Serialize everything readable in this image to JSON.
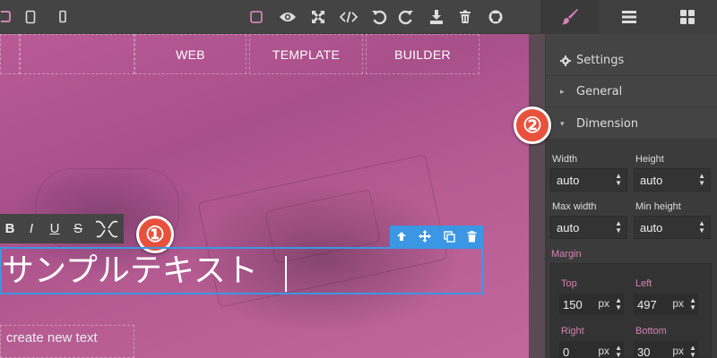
{
  "colors": {
    "accent_pink": "#d582b4",
    "accent_blue": "#3b97e3",
    "badge_red": "#e8513c",
    "panel_bg": "#444444"
  },
  "topbar": {
    "device_buttons": [
      {
        "icon": "desktop-icon",
        "active": true
      },
      {
        "icon": "tablet-icon",
        "active": false
      },
      {
        "icon": "mobile-icon",
        "active": false
      }
    ],
    "actions": [
      {
        "icon": "square-outline-icon",
        "active": true
      },
      {
        "icon": "eye-icon"
      },
      {
        "icon": "fullscreen-icon"
      },
      {
        "icon": "code-icon"
      },
      {
        "icon": "undo-icon"
      },
      {
        "icon": "redo-icon"
      },
      {
        "icon": "download-icon"
      },
      {
        "icon": "trash-icon"
      },
      {
        "icon": "github-icon"
      }
    ],
    "panel_tabs": [
      {
        "icon": "paintbrush-icon",
        "active": true
      },
      {
        "icon": "menu-icon",
        "active": false
      },
      {
        "icon": "grid-icon",
        "active": false
      }
    ]
  },
  "canvas": {
    "nav": [
      "WEB",
      "TEMPLATE",
      "BUILDER"
    ],
    "rte_buttons": [
      "B",
      "I",
      "U",
      "S"
    ],
    "selected_text": "サンプルテキスト",
    "placeholder_text": "create new text",
    "element_toolbar_icons": [
      "arrow-up-icon",
      "move-icon",
      "clone-icon",
      "delete-icon"
    ]
  },
  "annotations": {
    "badge_1": "①",
    "badge_2": "②"
  },
  "side_panel": {
    "settings_label": "Settings",
    "sections": [
      "General",
      "Dimension"
    ],
    "dimension": {
      "width": {
        "label": "Width",
        "value": "auto"
      },
      "height": {
        "label": "Height",
        "value": "auto"
      },
      "max_width": {
        "label": "Max width",
        "value": "auto"
      },
      "min_height": {
        "label": "Min height",
        "value": "auto"
      },
      "margin_label": "Margin",
      "margin": {
        "top": {
          "label": "Top",
          "value": "150",
          "unit": "px"
        },
        "left": {
          "label": "Left",
          "value": "497",
          "unit": "px"
        },
        "right": {
          "label": "Right",
          "value": "0",
          "unit": "px"
        },
        "bottom": {
          "label": "Bottom",
          "value": "30",
          "unit": "px"
        }
      }
    }
  }
}
